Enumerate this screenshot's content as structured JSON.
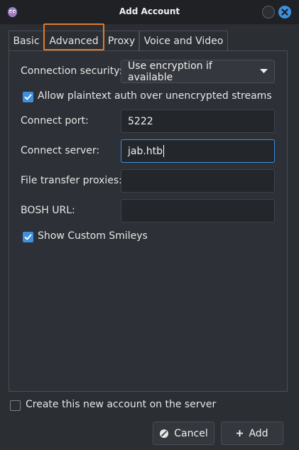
{
  "window": {
    "title": "Add Account"
  },
  "tabs": [
    {
      "label": "Basic",
      "active": false
    },
    {
      "label": "Advanced",
      "active": true
    },
    {
      "label": "Proxy",
      "active": false
    },
    {
      "label": "Voice and Video",
      "active": false
    }
  ],
  "advanced": {
    "connection_security": {
      "label": "Connection security:",
      "value": "Use encryption if available"
    },
    "allow_plaintext": {
      "label": "Allow plaintext auth over unencrypted streams",
      "checked": true
    },
    "connect_port": {
      "label": "Connect port:",
      "value": "5222"
    },
    "connect_server": {
      "label": "Connect server:",
      "value": "jab.htb"
    },
    "file_transfer_proxies": {
      "label": "File transfer proxies:",
      "value": ""
    },
    "bosh_url": {
      "label": "BOSH URL:",
      "value": ""
    },
    "show_custom_smileys": {
      "label": "Show Custom Smileys",
      "checked": true
    }
  },
  "footer": {
    "create_account": {
      "label": "Create this new account on the server",
      "checked": false
    },
    "cancel_label": "Cancel",
    "add_label": "Add"
  },
  "colors": {
    "accent": "#3d8fe0",
    "highlight": "#e07b2e",
    "background": "#2b2e33"
  }
}
